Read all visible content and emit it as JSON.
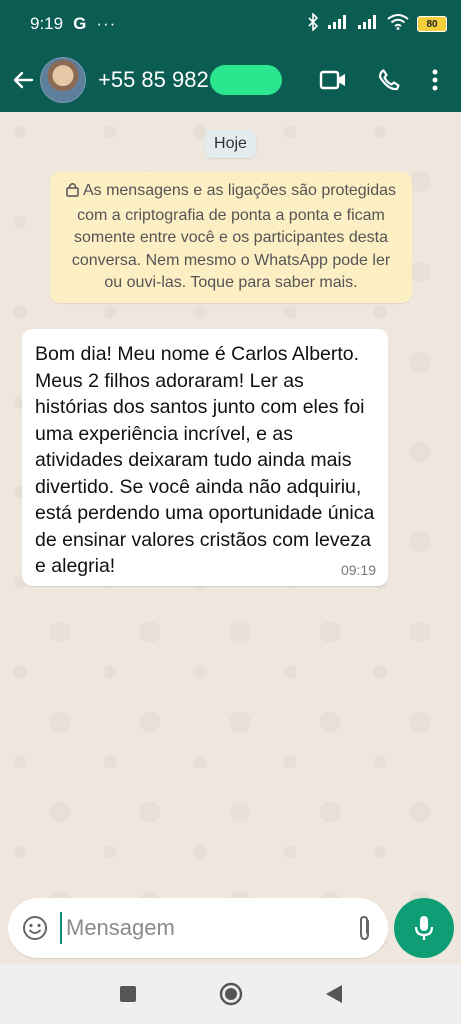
{
  "status_bar": {
    "time": "9:19",
    "battery": "80",
    "icons": [
      "google-icon",
      "more-notifications-icon",
      "bluetooth-icon",
      "signal-icon",
      "signal-icon",
      "wifi-icon",
      "battery-icon"
    ]
  },
  "header": {
    "contact_name": "+55 85 982        1",
    "icons": [
      "back-arrow-icon",
      "video-call-icon",
      "phone-icon",
      "more-vert-icon"
    ]
  },
  "chat": {
    "date_label": "Hoje",
    "encryption_notice": "As mensagens e as ligações são protegidas com a criptografia de ponta a ponta e ficam somente entre você e os participantes desta conversa. Nem mesmo o WhatsApp pode ler ou ouvi-las. Toque para saber mais.",
    "messages": [
      {
        "text": "Bom dia! Meu nome é Carlos Alberto. Meus 2 filhos adoraram! Ler as histórias dos santos junto com eles foi uma experiência incrível, e as atividades deixaram tudo ainda mais divertido. Se você ainda não adquiriu, está perdendo uma oportunidade única de ensinar valores cristãos com leveza e alegria!",
        "time": "09:19"
      }
    ]
  },
  "composer": {
    "placeholder": "Mensagem"
  },
  "colors": {
    "header": "#0b5c53",
    "chat_background": "#efe7de",
    "notice_background": "#fdefc4",
    "mic_button": "#0f9d75"
  }
}
